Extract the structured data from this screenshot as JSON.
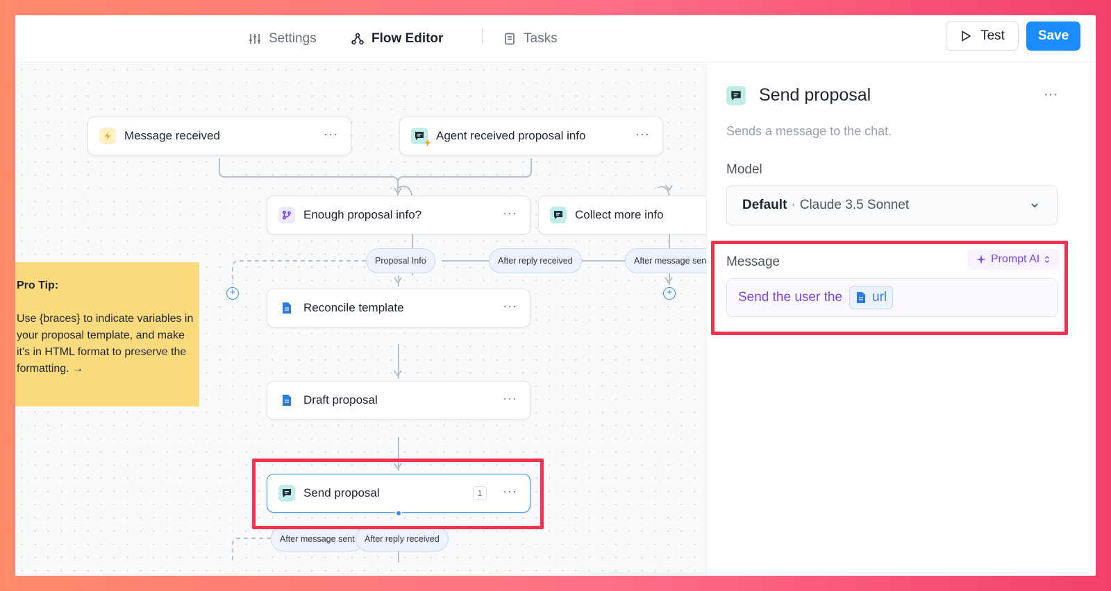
{
  "topbar": {
    "tabs": [
      {
        "label": "Settings",
        "icon": "sliders-icon"
      },
      {
        "label": "Flow Editor",
        "icon": "flow-icon"
      },
      {
        "label": "Tasks",
        "icon": "notebook-icon"
      }
    ],
    "test_label": "Test",
    "save_label": "Save"
  },
  "canvas": {
    "nodes": {
      "message_received": "Message received",
      "agent_received": "Agent received proposal info",
      "enough_info": "Enough proposal info?",
      "collect_more": "Collect more info",
      "reconcile": "Reconcile template",
      "draft": "Draft proposal",
      "send": "Send proposal",
      "send_badge": "1",
      "more": "···"
    },
    "edges": {
      "proposal_info": "Proposal Info",
      "after_reply_1": "After reply received",
      "after_message_1": "After message sen",
      "after_message_2": "After message sent",
      "after_reply_2": "After reply received"
    },
    "tip": {
      "title": "Pro Tip:",
      "body": "Use {braces} to indicate variables in your proposal template, and make it's in HTML format to preserve the formatting. →"
    }
  },
  "panel": {
    "title": "Send proposal",
    "more": "···",
    "description": "Sends a message to the chat.",
    "model_label": "Model",
    "model_value": "Default",
    "model_sep": "·",
    "model_sub": "Claude 3.5 Sonnet",
    "message_label": "Message",
    "prompt_ai": "Prompt AI",
    "message_text": "Send the user the",
    "chip_label": "url"
  },
  "colors": {
    "accent": "#1a8cff",
    "highlight": "#f0334e",
    "prompt_purple": "#7a46e0",
    "tip_yellow": "#fadb7e"
  }
}
